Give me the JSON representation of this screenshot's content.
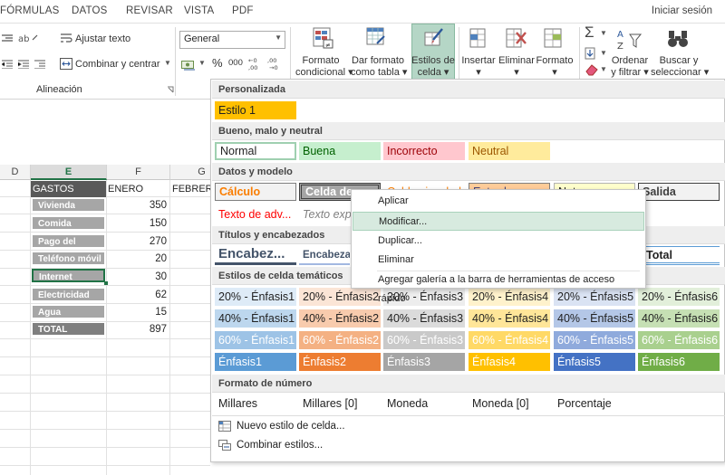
{
  "menu": {
    "tabs": [
      "FÓRMULAS",
      "DATOS",
      "REVISAR",
      "VISTA",
      "PDF"
    ],
    "signin": "Iniciar sesión"
  },
  "ribbon": {
    "wrap_text": "Ajustar texto",
    "merge_center": "Combinar y centrar",
    "alignment_group": "Alineación",
    "number_format": "General",
    "percent": "%",
    "thousands": "000",
    "cond_format": [
      "Formato",
      "condicional"
    ],
    "format_table": [
      "Dar formato",
      "como tabla"
    ],
    "cell_styles": [
      "Estilos de",
      "celda"
    ],
    "insert": "Insertar",
    "delete": "Eliminar",
    "format": "Formato",
    "sigma": "Σ",
    "sort_filter": [
      "Ordenar",
      "y filtrar"
    ],
    "find_select": [
      "Buscar y",
      "seleccionar"
    ]
  },
  "sheet": {
    "columns": [
      {
        "label": "D",
        "active": false
      },
      {
        "label": "E",
        "active": true
      },
      {
        "label": "F",
        "active": false
      },
      {
        "label": "G",
        "active": false
      }
    ],
    "headers": [
      "GASTOS",
      "ENERO",
      "FEBRERO"
    ],
    "rows": [
      {
        "name": "Vivienda",
        "value": "350"
      },
      {
        "name": "Comida",
        "value": "150"
      },
      {
        "name": "Pago del coche",
        "value": "270"
      },
      {
        "name": "Teléfono móvil",
        "value": "20"
      },
      {
        "name": "Internet",
        "value": "30"
      },
      {
        "name": "Electricidad",
        "value": "62"
      },
      {
        "name": "Agua",
        "value": "15"
      },
      {
        "name": "TOTAL",
        "value": "897"
      }
    ]
  },
  "gallery": {
    "sections": {
      "custom": "Personalizada",
      "good_bad": "Bueno, malo y neutral",
      "data_model": "Datos y modelo",
      "titles": "Títulos y encabezados",
      "themed": "Estilos de celda temáticos",
      "number_format": "Formato de número"
    },
    "custom_styles": [
      "Estilo 1"
    ],
    "good_bad_styles": [
      "Normal",
      "Buena",
      "Incorrecto",
      "Neutral"
    ],
    "data_model_row1": [
      "Cálculo",
      "Celda de c",
      "Celda vinculada",
      "Entrada",
      "Notas",
      "Salida"
    ],
    "data_model_row2": [
      "Texto de adv...",
      "Texto exp"
    ],
    "title_styles": [
      "Encabez...",
      "Encabezad",
      "Total"
    ],
    "themed_rows": [
      [
        "20% - Énfasis1",
        "20% - Énfasis2",
        "20% - Énfasis3",
        "20% - Énfasis4",
        "20% - Énfasis5",
        "20% - Énfasis6"
      ],
      [
        "40% - Énfasis1",
        "40% - Énfasis2",
        "40% - Énfasis3",
        "40% - Énfasis4",
        "40% - Énfasis5",
        "40% - Énfasis6"
      ],
      [
        "60% - Énfasis1",
        "60% - Énfasis2",
        "60% - Énfasis3",
        "60% - Énfasis4",
        "60% - Énfasis5",
        "60% - Énfasis6"
      ],
      [
        "Énfasis1",
        "Énfasis2",
        "Énfasis3",
        "Énfasis4",
        "Énfasis5",
        "Énfasis6"
      ]
    ],
    "number_styles": [
      "Millares",
      "Millares [0]",
      "Moneda",
      "Moneda [0]",
      "Porcentaje"
    ],
    "footer": {
      "new_style": "Nuevo estilo de celda...",
      "merge_styles": "Combinar estilos..."
    }
  },
  "context_menu": {
    "items": [
      "Aplicar",
      "Modificar...",
      "Duplicar...",
      "Eliminar",
      "Agregar galería a la barra de herramientas de acceso rápido"
    ],
    "highlighted": 1
  },
  "colors": {
    "accent_green": "#217346",
    "estilo1": "#ffc000",
    "buena_bg": "#c6efce",
    "buena_fg": "#006100",
    "incorrecto_bg": "#ffc7ce",
    "incorrecto_fg": "#9c0006",
    "neutral_bg": "#ffeb9c",
    "neutral_fg": "#9c5700",
    "accent1": "#5b9bd5",
    "accent2": "#ed7d31",
    "accent3": "#a5a5a5",
    "accent4": "#ffc000",
    "accent5": "#4472c4",
    "accent6": "#70ad47"
  }
}
